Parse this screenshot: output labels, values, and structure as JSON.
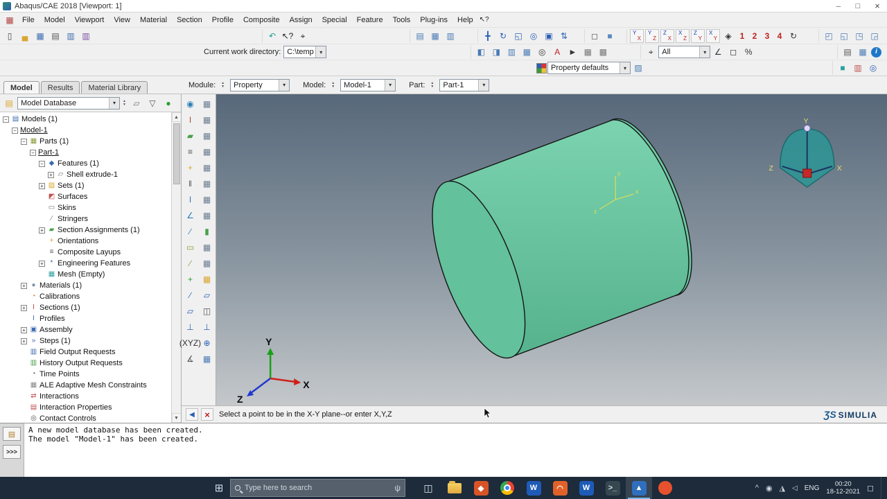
{
  "window": {
    "title": "Abaqus/CAE 2018 [Viewport: 1]"
  },
  "menu": {
    "items": [
      "File",
      "Model",
      "Viewport",
      "View",
      "Material",
      "Section",
      "Profile",
      "Composite",
      "Assign",
      "Special",
      "Feature",
      "Tools",
      "Plug-ins",
      "Help"
    ]
  },
  "toolbars": {
    "row1": {
      "groups": [
        {
          "name": "file",
          "items": [
            "new-model-icon",
            "open-icon",
            "save-icon",
            "print-icon",
            "report-icon",
            "journal-icon"
          ]
        },
        {
          "name": "tools",
          "items": [
            "undo-icon",
            "context-help-icon",
            "probe-icon"
          ]
        },
        {
          "name": "tables",
          "items": [
            "cut-table-icon",
            "view-cut-icon",
            "display-group-icon"
          ]
        },
        {
          "name": "viewmanip",
          "items": [
            "pan-icon",
            "rotate-view-icon",
            "zoom-box-icon",
            "magnify-icon",
            "fit-view-icon",
            "cycle-views-icon"
          ]
        },
        {
          "name": "render",
          "items": [
            "wireframe-icon",
            "shaded-icon"
          ]
        },
        {
          "name": "views",
          "items": [
            {
              "name": "view-front-icon",
              "text": "YX"
            },
            {
              "name": "view-back-icon",
              "text": "YZ"
            },
            {
              "name": "view-top-icon",
              "text": "ZX"
            },
            {
              "name": "view-bottom-icon",
              "text": "XZ"
            },
            {
              "name": "view-left-icon",
              "text": "ZY"
            },
            {
              "name": "view-right-icon",
              "text": "XY"
            },
            "iso-view-icon",
            {
              "name": "saved-view-1-icon",
              "text": "1"
            },
            {
              "name": "saved-view-2-icon",
              "text": "2"
            },
            {
              "name": "saved-view-3-icon",
              "text": "3"
            },
            {
              "name": "saved-view-4-icon",
              "text": "4"
            },
            "spin-view-icon"
          ]
        },
        {
          "name": "vpright",
          "items": [
            "new-viewport-icon",
            "tile-viewports-icon",
            "viewport-decor-icon",
            "lock-viewport-icon"
          ]
        }
      ]
    },
    "row2": {
      "groups": [
        {
          "name": "workdir",
          "items": [
            {
              "label": "Current work directory:"
            },
            {
              "combo": {
                "name": "work-directory-combo",
                "value": "C:\\temp"
              }
            }
          ]
        },
        {
          "name": "vptools",
          "items": [
            "viewport-back-icon",
            "viewport-front-icon",
            "viewport-raise-icon",
            "viewport-lower-icon",
            "binoculars-icon",
            "annotation-icon",
            "pointer-icon",
            "grid-on-icon",
            "grid-snap-icon"
          ]
        },
        {
          "name": "selection",
          "items": [
            "select-from-all-icon",
            {
              "combo": {
                "name": "selection-combo",
                "value": "All"
              }
            },
            "angle-select-icon",
            "box-select-icon",
            "percent-select-icon"
          ]
        },
        {
          "name": "right2",
          "items": [
            "layers-icon",
            "query-table-icon",
            "info-icon"
          ]
        }
      ]
    },
    "row3": {
      "groups": [
        {
          "name": "colorcode",
          "items": [
            "palette-icon",
            {
              "combo": {
                "name": "color-code-combo",
                "value": "Property defaults"
              }
            },
            "color-options-icon"
          ]
        },
        {
          "name": "right3",
          "items": [
            "teal-cube-icon",
            "spectrum-icon",
            "compass-tool-icon"
          ]
        }
      ]
    }
  },
  "context_bar": {
    "module_label": "Module:",
    "module_value": "Property",
    "model_label": "Model:",
    "model_value": "Model-1",
    "part_label": "Part:",
    "part_value": "Part-1"
  },
  "left_panel": {
    "tabs": [
      {
        "label": "Model",
        "active": true
      },
      {
        "label": "Results",
        "active": false
      },
      {
        "label": "Material Library",
        "active": false
      }
    ],
    "database_combo": "Model Database",
    "toolbar_icons": [
      "tree-edit-icon",
      "filter-icon",
      "pin-icon"
    ],
    "tree": [
      {
        "label": "Models (1)",
        "level": 0,
        "expander": "minus",
        "icon": "models-icon"
      },
      {
        "label": "Model-1",
        "level": 1,
        "expander": "minus",
        "underline": true
      },
      {
        "label": "Parts (1)",
        "level": 2,
        "expander": "minus",
        "icon": "parts-icon"
      },
      {
        "label": "Part-1",
        "level": 3,
        "expander": "minus",
        "underline": true
      },
      {
        "label": "Features (1)",
        "level": 4,
        "expander": "minus",
        "icon": "features-icon"
      },
      {
        "label": "Shell extrude-1",
        "level": 5,
        "expander": "plus",
        "icon": "shell-extrude-icon"
      },
      {
        "label": "Sets (1)",
        "level": 4,
        "expander": "plus",
        "icon": "sets-icon"
      },
      {
        "label": "Surfaces",
        "level": 4,
        "icon": "surfaces-icon"
      },
      {
        "label": "Skins",
        "level": 4,
        "icon": "skins-icon"
      },
      {
        "label": "Stringers",
        "level": 4,
        "icon": "stringers-icon"
      },
      {
        "label": "Section Assignments (1)",
        "level": 4,
        "expander": "plus",
        "icon": "section-assignments-icon"
      },
      {
        "label": "Orientations",
        "level": 4,
        "icon": "orientations-icon"
      },
      {
        "label": "Composite Layups",
        "level": 4,
        "icon": "composite-layups-icon"
      },
      {
        "label": "Engineering Features",
        "level": 4,
        "expander": "plus",
        "icon": "engineering-features-icon"
      },
      {
        "label": "Mesh (Empty)",
        "level": 4,
        "icon": "mesh-icon"
      },
      {
        "label": "Materials (1)",
        "level": 2,
        "expander": "plus",
        "icon": "materials-icon"
      },
      {
        "label": "Calibrations",
        "level": 2,
        "icon": "calibrations-icon"
      },
      {
        "label": "Sections (1)",
        "level": 2,
        "expander": "plus",
        "icon": "sections-icon"
      },
      {
        "label": "Profiles",
        "level": 2,
        "icon": "profiles-icon"
      },
      {
        "label": "Assembly",
        "level": 2,
        "expander": "plus",
        "icon": "assembly-icon"
      },
      {
        "label": "Steps (1)",
        "level": 2,
        "expander": "plus",
        "icon": "steps-icon"
      },
      {
        "label": "Field Output Requests",
        "level": 2,
        "icon": "field-output-icon"
      },
      {
        "label": "History Output Requests",
        "level": 2,
        "icon": "history-output-icon"
      },
      {
        "label": "Time Points",
        "level": 2,
        "icon": "time-points-icon"
      },
      {
        "label": "ALE Adaptive Mesh Constraints",
        "level": 2,
        "icon": "ale-icon"
      },
      {
        "label": "Interactions",
        "level": 2,
        "icon": "interactions-icon"
      },
      {
        "label": "Interaction Properties",
        "level": 2,
        "icon": "interaction-properties-icon"
      },
      {
        "label": "Contact Controls",
        "level": 2,
        "icon": "contact-controls-icon"
      }
    ]
  },
  "toolbox": {
    "items": [
      "create-material-icon",
      "material-manager-icon",
      "create-section-icon",
      "section-manager-icon",
      "assign-section-icon",
      "section-assignment-manager-icon",
      "create-composite-layup-icon",
      "composite-layup-manager-icon",
      "assign-material-orientation-icon",
      "material-orientation-manager-icon",
      "assign-rebar-orientation-icon",
      "rebar-orientation-manager-icon",
      "create-profile-icon",
      "profile-manager-icon",
      "assign-beam-orientation-icon",
      "beam-orientation-manager-icon",
      "assign-beam-tangent-icon",
      "render-beam-profiles-icon",
      "create-skin-icon",
      "skin-manager-icon",
      "create-stringer-icon",
      "stringer-manager-icon",
      "create-datum-point-icon",
      "datum-grid-icon",
      "create-datum-axis-icon",
      "datum-plane2-icon",
      "create-datum-plane-icon",
      "partition-icon",
      "create-datum-csys-icon",
      "axis-tool-icon",
      {
        "name": "xyz-point-icon",
        "text": "(XYZ)"
      },
      "csys-tool-icon",
      "measure-icon",
      "options-table-icon"
    ]
  },
  "viewport": {
    "prompt": "Select a point to be in the X-Y plane--or enter X,Y,Z",
    "triad": {
      "x": "X",
      "y": "Y",
      "z": "Z"
    },
    "compass": {
      "x": "X",
      "y": "Y",
      "z": "Z"
    },
    "csys": {
      "x": "x",
      "y": "y",
      "z": "z"
    },
    "brand_mark": "ƷS",
    "brand": "SIMULIA"
  },
  "messages": {
    "lines": [
      "A new model database has been created.",
      "The model \"Model-1\" has been created."
    ],
    "cli": ">>>"
  },
  "taskbar": {
    "search": {
      "placeholder": "Type here to search"
    },
    "apps": [
      {
        "name": "task-view-button"
      },
      {
        "name": "file-explorer-button"
      },
      {
        "name": "app-orange-button"
      },
      {
        "name": "chrome-button"
      },
      {
        "name": "word-button"
      },
      {
        "name": "matlab-button"
      },
      {
        "name": "word2-button"
      },
      {
        "name": "terminal-button"
      },
      {
        "name": "abaqus-active-button",
        "active": true
      },
      {
        "name": "browser-orange-button"
      }
    ],
    "tray": {
      "language": "ENG",
      "time": "00:20",
      "date": "18-12-2021"
    }
  },
  "colors": {
    "cylinder": "#66c5a0",
    "canvas_top": "#57687a",
    "canvas_bottom": "#c4c8cb",
    "taskbar": "#1d2b3a",
    "compass": "#2d9494"
  }
}
